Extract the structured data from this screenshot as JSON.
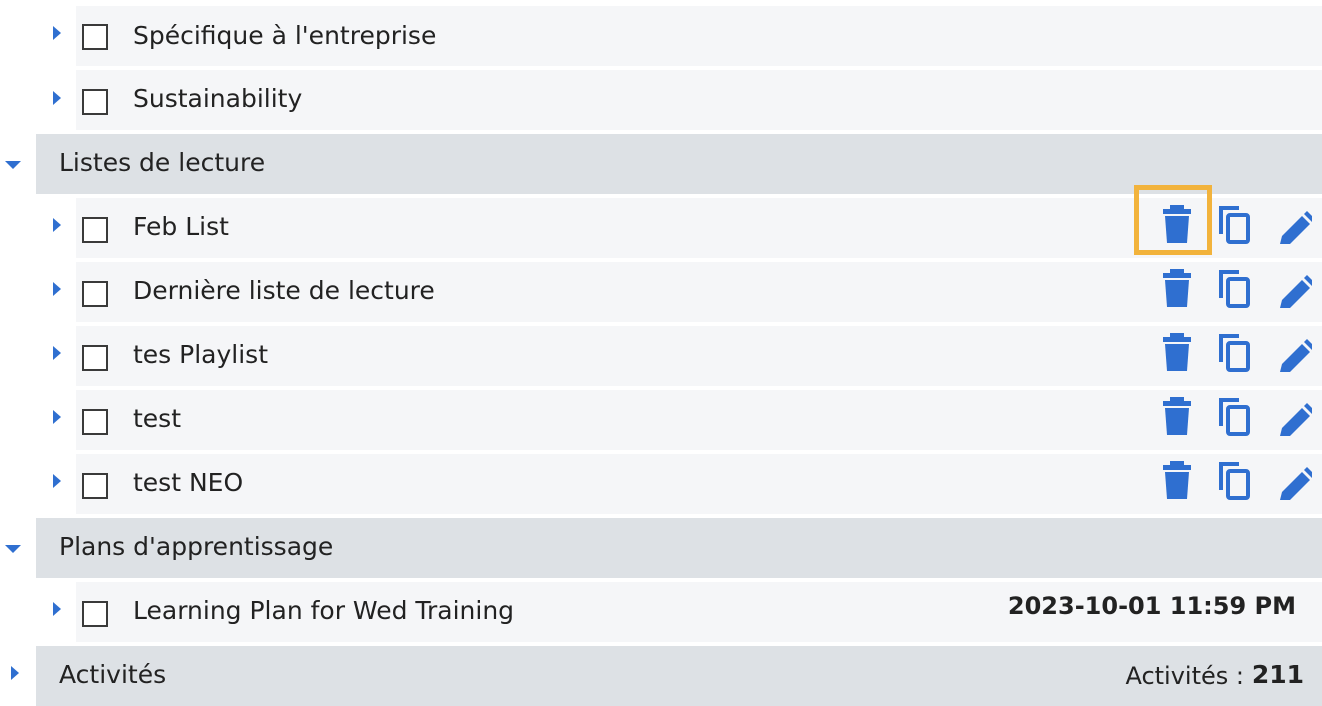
{
  "items_top": [
    {
      "label": "Spécifique à l'entreprise"
    },
    {
      "label": "Sustainability"
    }
  ],
  "groups": {
    "reading_lists": {
      "label": "Listes de lecture"
    },
    "learning_plans": {
      "label": "Plans d'apprentissage"
    },
    "activities": {
      "label": "Activités",
      "count_label": "Activités :",
      "count_value": "211"
    }
  },
  "reading_lists": [
    {
      "label": "Feb List"
    },
    {
      "label": "Dernière liste de lecture"
    },
    {
      "label": "tes Playlist"
    },
    {
      "label": "test"
    },
    {
      "label": "test NEO"
    }
  ],
  "learning_plans": [
    {
      "label": "Learning Plan for Wed Training",
      "date": "2023-10-01 11:59 PM"
    }
  ],
  "icons": {
    "delete": "trash-icon",
    "copy": "copy-icon",
    "edit": "pencil-icon",
    "expand": "caret-right-icon",
    "collapse": "caret-down-icon"
  },
  "colors": {
    "accent": "#2f6fd0",
    "highlight": "#f2b33c",
    "group_bg": "#dde1e5",
    "item_bg": "#f5f6f8"
  }
}
